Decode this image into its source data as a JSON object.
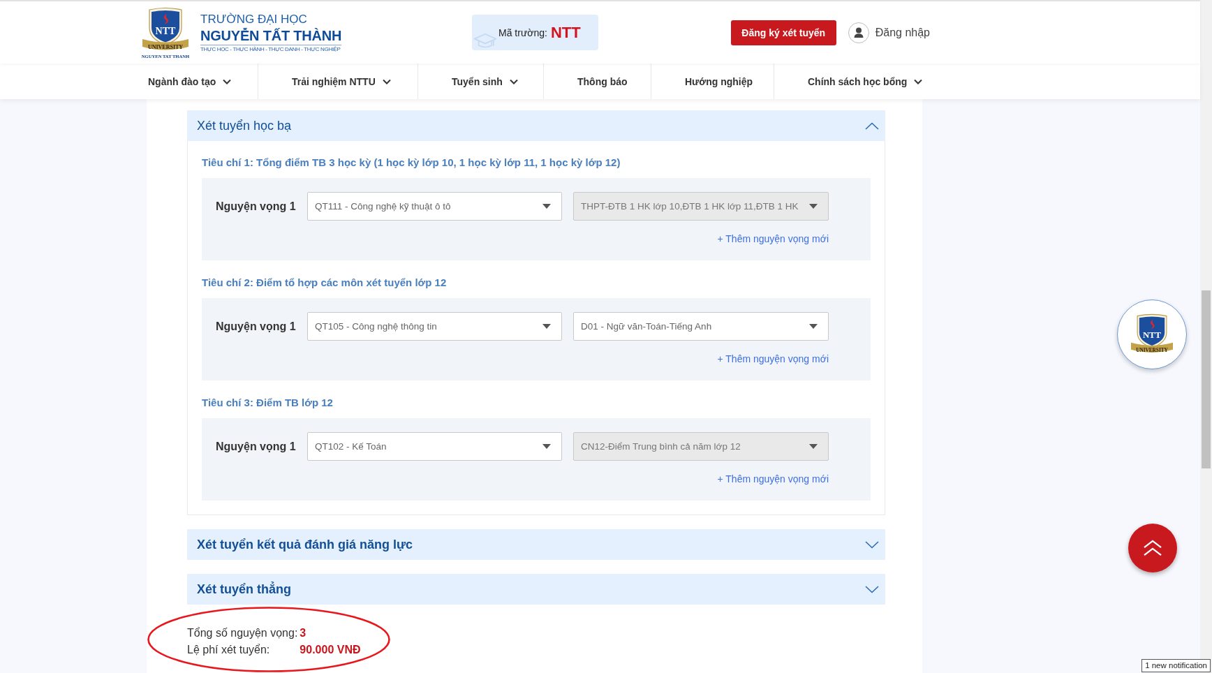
{
  "header": {
    "logo": {
      "monogram": "NTT",
      "ribbon": "UNIVERSITY",
      "caption": "NGUYEN TAT THANH"
    },
    "school_line": "TRƯỜNG ĐẠI HỌC",
    "school_name": "NGUYỄN TẤT THÀNH",
    "tagline": "THỰC HỌC - THỰC HÀNH - THỰC DANH - THỰC NGHIỆP",
    "school_code": {
      "label": "Mã trường:",
      "value": "NTT"
    },
    "register_button": "Đăng ký xét tuyển",
    "login": "Đăng nhập"
  },
  "nav": [
    {
      "label": "Ngành đào tạo",
      "has_menu": true
    },
    {
      "label": "Trải nghiệm NTTU",
      "has_menu": true
    },
    {
      "label": "Tuyển sinh",
      "has_menu": true
    },
    {
      "label": "Thông báo",
      "has_menu": false
    },
    {
      "label": "Hướng nghiệp",
      "has_menu": false
    },
    {
      "label": "Chính sách học bổng",
      "has_menu": true
    }
  ],
  "sections": [
    {
      "title": "Xét tuyển học bạ",
      "expanded": true,
      "criteria": [
        {
          "title": "Tiêu chí 1: Tổng điểm TB 3 học kỳ (1 học kỳ lớp 10, 1 học kỳ lớp 11, 1 học kỳ lớp 12)",
          "wishes": [
            {
              "label": "Nguyện vọng 1",
              "major": "QT111 - Công nghệ kỹ thuật ô tô",
              "combination": {
                "value": "THPT-ĐTB 1 HK lớp 10,ĐTB 1 HK lớp 11,ĐTB 1 HK",
                "disabled": true
              }
            }
          ],
          "add_link": "+ Thêm nguyện vọng mới"
        },
        {
          "title": "Tiêu chí 2: Điểm tổ hợp các môn xét tuyển lớp 12",
          "wishes": [
            {
              "label": "Nguyện vọng 1",
              "major": "QT105 - Công nghệ thông tin",
              "combination": {
                "value": "D01 - Ngữ văn-Toán-Tiếng Anh",
                "disabled": false
              }
            }
          ],
          "add_link": "+ Thêm nguyện vọng mới"
        },
        {
          "title": "Tiêu chí 3: Điểm TB lớp 12",
          "wishes": [
            {
              "label": "Nguyện vọng 1",
              "major": "QT102 - Kế Toán",
              "combination": {
                "value": "CN12-Điểm Trung bình cả năm lớp 12",
                "disabled": true
              }
            }
          ],
          "add_link": "+ Thêm nguyện vọng mới"
        }
      ]
    },
    {
      "title": "Xét tuyển kết quả đánh giá năng lực",
      "expanded": false
    },
    {
      "title": "Xét tuyển thẳng",
      "expanded": false
    }
  ],
  "summary": [
    {
      "label": "Tổng số nguyện vọng:",
      "value": "3"
    },
    {
      "label": "Lệ phí xét tuyển:",
      "value": "90.000 VNĐ"
    }
  ],
  "floating_logo": {
    "monogram": "NTT",
    "ribbon": "UNIVERSITY"
  },
  "notification": "1 new notification"
}
